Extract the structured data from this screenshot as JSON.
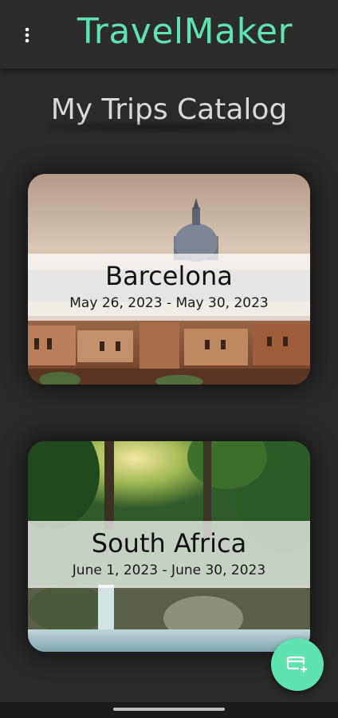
{
  "app": {
    "title": "TravelMaker",
    "accent_color": "#5fe3b0"
  },
  "header": {
    "menu_icon": "more-vert-icon"
  },
  "page": {
    "heading": "My Trips Catalog"
  },
  "trips": [
    {
      "name": "Barcelona",
      "dates": "May 26, 2023 - May 30, 2023",
      "image": "city-domes-photo"
    },
    {
      "name": "South Africa",
      "dates": "June 1, 2023 - June 30, 2023",
      "image": "forest-waterfall-photo"
    }
  ],
  "fab": {
    "icon": "add-card-icon"
  }
}
